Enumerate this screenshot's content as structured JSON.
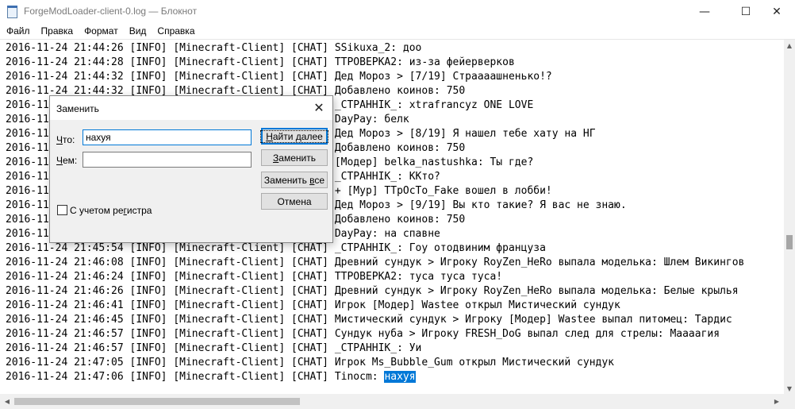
{
  "window": {
    "title": "ForgeModLoader-client-0.log — Блокнот",
    "minimize_glyph": "—",
    "maximize_glyph": "☐",
    "close_glyph": "✕"
  },
  "menu": [
    "Файл",
    "Правка",
    "Формат",
    "Вид",
    "Справка"
  ],
  "editor": {
    "selected_text": "нахуя",
    "lines": [
      "2016-11-24 21:44:26 [INFO] [Minecraft-Client] [CHAT] SSikuxa_2: доо",
      "2016-11-24 21:44:28 [INFO] [Minecraft-Client] [CHAT] ТТРОВЕРКА2: из-за фейерверков",
      "2016-11-24 21:44:32 [INFO] [Minecraft-Client] [CHAT] Дед Мороз > [7/19] Страааашненько!?",
      "2016-11-24 21:44:32 [INFO] [Minecraft-Client] [CHAT] Добавлено коинов: 750",
      "2016-11-24 21:44:38 [INFO] [Minecraft-Client] [CHAT] _СТРАННIK_: xtrafrancyz ONE LOVE",
      "2016-11-24 21:44:42 [INFO] [Minecraft-Client] [CHAT] DayPay: белк",
      "2016-11-24 21:44:46 [INFO] [Minecraft-Client] [CHAT] Дед Мороз > [8/19] Я нашел тебе хату на НГ",
      "2016-11-24 21:44:46 [INFO] [Minecraft-Client] [CHAT] Добавлено коинов: 750",
      "2016-11-24 21:44:52 [INFO] [Minecraft-Client] [CHAT] [Модер] belka_nastushka: Ты где?",
      "2016-11-24 21:44:58 [INFO] [Minecraft-Client] [CHAT] _СТРАННIK_: ККто?",
      "2016-11-24 21:45:10 [INFO] [Minecraft-Client] [CHAT] + [Мур] ТТрОсТо_Fake вошел в лобби!",
      "2016-11-24 21:45:20 [INFO] [Minecraft-Client] [CHAT] Дед Мороз > [9/19] Вы кто такие? Я вас не знаю.",
      "2016-11-24 21:45:20 [INFO] [Minecraft-Client] [CHAT] Добавлено коинов: 750",
      "2016-11-24 21:45:36 [INFO] [Minecraft-Client] [CHAT] DayPay: на спавне",
      "2016-11-24 21:45:54 [INFO] [Minecraft-Client] [CHAT] _СТРАННIK_: Гоу отодвиним француза",
      "2016-11-24 21:46:08 [INFO] [Minecraft-Client] [CHAT] Древний сундук > Игроку RoyZen_HeRo выпала моделька: Шлем Викингов",
      "2016-11-24 21:46:24 [INFO] [Minecraft-Client] [CHAT] ТТРОВЕРКА2: туса туса туса!",
      "2016-11-24 21:46:26 [INFO] [Minecraft-Client] [CHAT] Древний сундук > Игроку RoyZen_HeRo выпала моделька: Белые крылья",
      "2016-11-24 21:46:41 [INFO] [Minecraft-Client] [CHAT] Игрок [Модер] Wastee открыл Мистический сундук",
      "2016-11-24 21:46:45 [INFO] [Minecraft-Client] [CHAT] Мистический сундук > Игроку [Модер] Wastee выпал питомец: Тардис",
      "2016-11-24 21:46:57 [INFO] [Minecraft-Client] [CHAT] Сундук нуба > Игроку FRESH_DoG выпал след для стрелы: Маааагия",
      "2016-11-24 21:46:57 [INFO] [Minecraft-Client] [CHAT] _СТРАННIK_: Уи",
      "2016-11-24 21:47:05 [INFO] [Minecraft-Client] [CHAT] Игрок Ms_Bubble_Gum открыл Мистический сундук",
      "2016-11-24 21:47:06 [INFO] [Minecraft-Client] [CHAT] Tinocm: "
    ]
  },
  "dialog": {
    "title": "Заменить",
    "close_glyph": "✕",
    "find_label_hot": "Ч",
    "find_label_rest": "то:",
    "find_value": "нахуя",
    "replace_label_hot": "Ч",
    "replace_label_rest": "ем:",
    "replace_value": "",
    "btn_find_next_hot": "Н",
    "btn_find_next_rest": "айти далее",
    "btn_replace_hot": "З",
    "btn_replace_rest": "аменить",
    "btn_replace_all_pre": "Заменить ",
    "btn_replace_all_hot": "в",
    "btn_replace_all_post": "се",
    "btn_cancel": "Отмена",
    "match_case_pre": "С учетом ре",
    "match_case_hot": "г",
    "match_case_post": "истра"
  }
}
